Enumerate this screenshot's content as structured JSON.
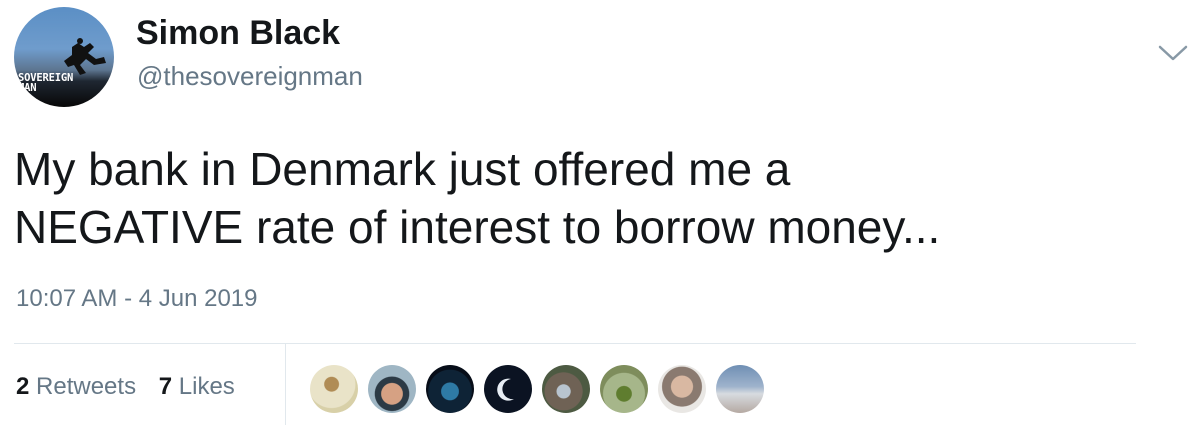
{
  "user": {
    "display_name": "Simon Black",
    "handle": "@thesovereignman",
    "avatar_logo_text": "SOVEREIGN\nMAN"
  },
  "tweet": {
    "text": "My bank in Denmark just offered me a\nNEGATIVE rate of interest to borrow money...",
    "timestamp": "10:07 AM - 4 Jun 2019"
  },
  "stats": {
    "retweets_count": "2",
    "retweets_label": "Retweets",
    "likes_count": "7",
    "likes_label": "Likes"
  },
  "icons": {
    "menu": "chevron-down-icon"
  },
  "colors": {
    "text_primary": "#14171a",
    "text_secondary": "#657786",
    "divider": "#e1e8ed"
  }
}
